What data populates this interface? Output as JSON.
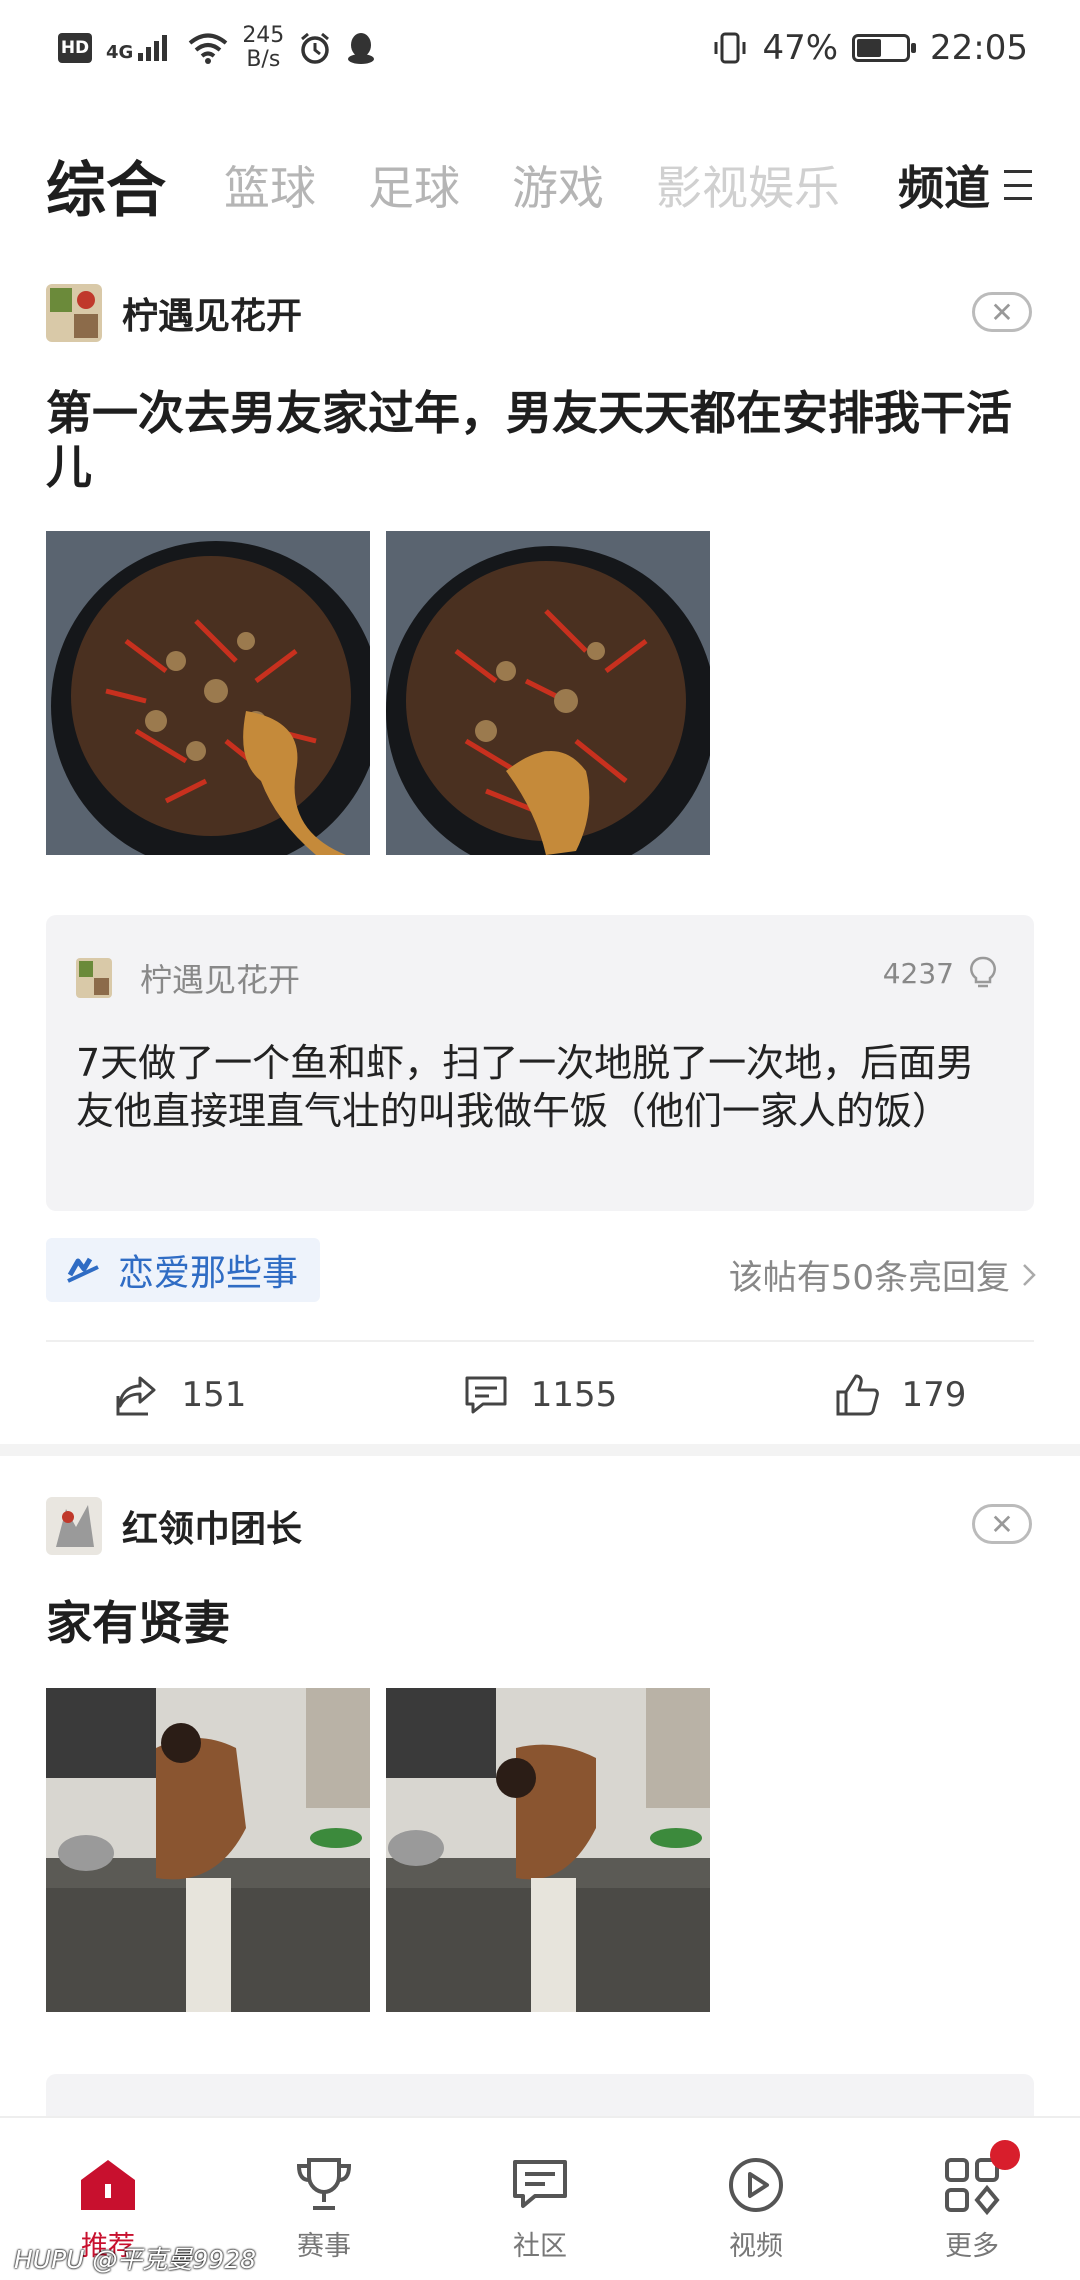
{
  "status_bar": {
    "hd": "HD",
    "network": "4G",
    "speed_value": "245",
    "speed_unit": "B/s",
    "battery_pct": "47%",
    "battery_level": 0.47,
    "time": "22:05"
  },
  "channels": {
    "tabs": [
      "综合",
      "篮球",
      "足球",
      "游戏",
      "影视娱乐"
    ],
    "channel_label": "频道"
  },
  "posts": [
    {
      "author": "柠遇见花开",
      "title": "第一次去男友家过年，男友天天都在安排我干活儿",
      "hot_reply": {
        "author": "柠遇见花开",
        "likes": "4237",
        "text": "7天做了一个鱼和虾，扫了一次地脱了一次地，后面男友他直接理直气壮的叫我做午饭（他们一家人的饭）"
      },
      "topic": "恋爱那些事",
      "reply_count_text": "该帖有50条亮回复",
      "shares": "151",
      "comments": "1155",
      "likes": "179"
    },
    {
      "author": "红领巾团长",
      "title": "家有贤妻"
    }
  ],
  "bottom_nav": [
    {
      "label": "推荐"
    },
    {
      "label": "赛事"
    },
    {
      "label": "社区"
    },
    {
      "label": "视频"
    },
    {
      "label": "更多"
    }
  ],
  "watermark": "HUPU @平克曼9928"
}
